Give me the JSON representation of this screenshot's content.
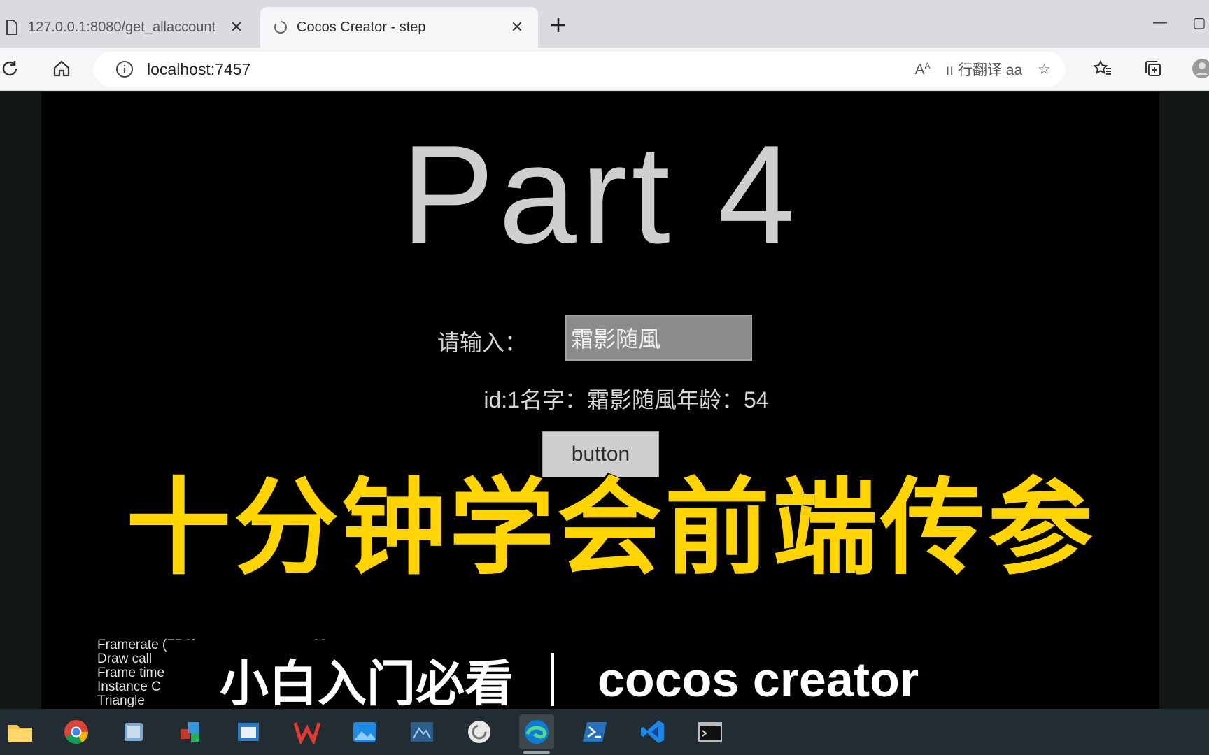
{
  "browser": {
    "tabs": [
      {
        "title": "127.0.0.1:8080/get_allaccount",
        "active": false,
        "icon": "page-icon"
      },
      {
        "title": "Cocos Creator - step",
        "active": true,
        "icon": "cocos-icon"
      }
    ],
    "new_tab_icon": "plus-icon",
    "address": "localhost:7457",
    "toolbar_text": "ıı 行翻译 aa"
  },
  "game": {
    "heading": "Part 4",
    "input_label": "请输入：",
    "input_value": "霜影随風",
    "result_text": "id:1名字：霜影随風年龄：54",
    "button_label": "button",
    "stats": {
      "labels": [
        "Framerate (FPS)",
        "Draw call",
        "Frame time",
        "Instance C",
        "Triangle"
      ],
      "fps_value": "60"
    }
  },
  "overlay": {
    "title": "十分钟学会前端传参",
    "subtitle_left": "小白入门必看",
    "subtitle_right": "cocos creator",
    "title_color": "#ffd400"
  },
  "taskbar": {
    "icons": [
      "file-explorer-icon",
      "chrome-icon",
      "app-icon",
      "app-icon-2",
      "window-icon",
      "wps-icon",
      "photos-icon",
      "app-icon-3",
      "cocos-icon",
      "edge-icon",
      "powershell-icon",
      "vscode-icon",
      "terminal-icon"
    ]
  }
}
